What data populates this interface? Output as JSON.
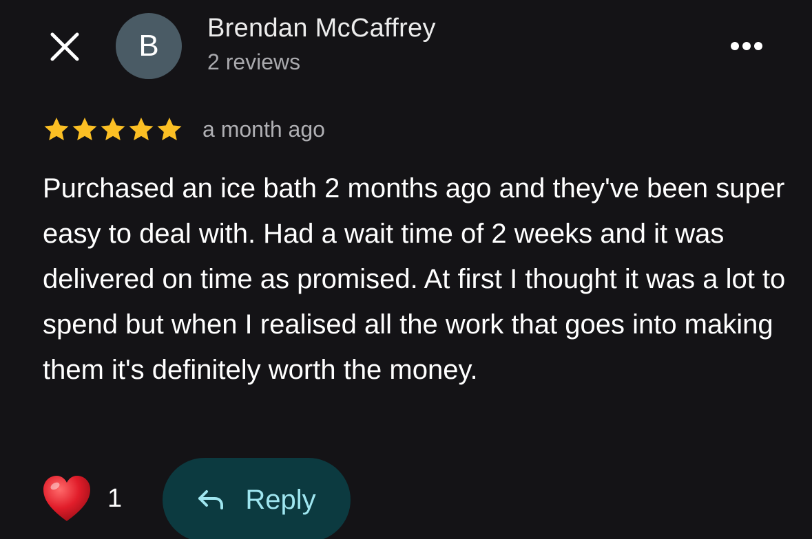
{
  "header": {
    "close_icon": "close-icon",
    "avatar_initial": "B",
    "author_name": "Brendan McCaffrey",
    "review_count": "2 reviews",
    "more_icon": "more-horizontal-icon"
  },
  "review": {
    "rating": 5,
    "rating_max": 5,
    "star_color": "#fbbf24",
    "time": "a month ago",
    "text": "Purchased an ice bath 2 months ago and they've been super easy to deal with. Had a wait time of 2 weeks and it was delivered on time as promised. At first I thought it was a lot to spend but when I realised all the work that goes into making them it's definitely worth the money."
  },
  "actions": {
    "like_icon": "heart-icon",
    "like_count": "1",
    "reply_icon": "reply-arrow-icon",
    "reply_label": "Reply"
  },
  "colors": {
    "background": "#141316",
    "avatar_bg": "#4a5b65",
    "reply_bg": "#0c3a40",
    "reply_text": "#9fe6f0",
    "heart": "#e53935"
  }
}
